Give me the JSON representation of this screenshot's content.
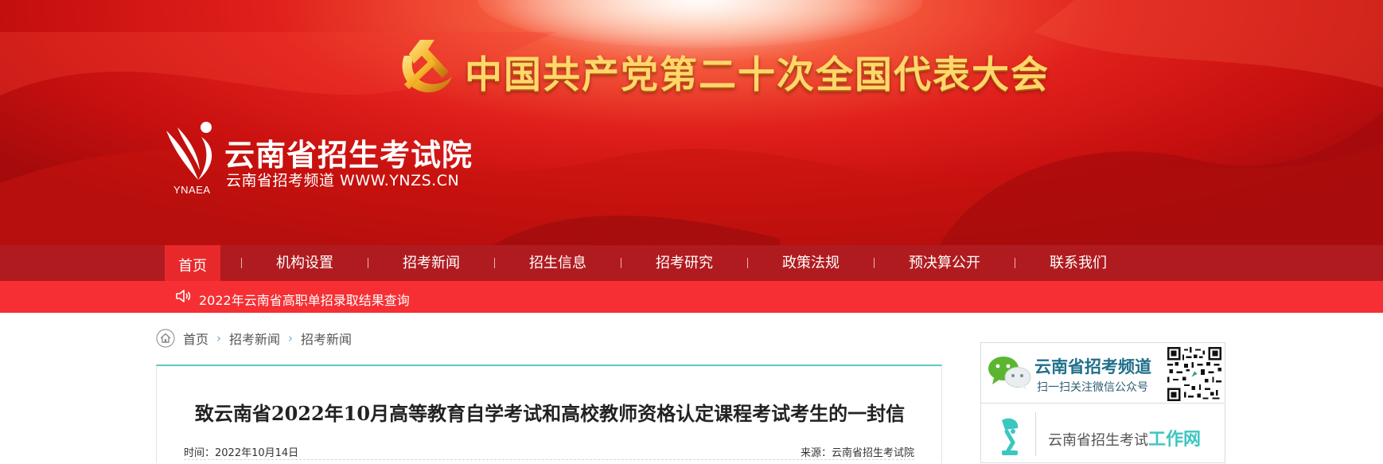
{
  "banner": {
    "congress_title": "中国共产党第二十次全国代表大会",
    "site_name": "云南省招生考试院",
    "site_subtitle": "云南省招考频道 WWW.YNZS.CN",
    "logo_abbr": "YNAEA"
  },
  "nav": {
    "items": [
      {
        "label": "首页"
      },
      {
        "label": "机构设置"
      },
      {
        "label": "招考新闻"
      },
      {
        "label": "招生信息"
      },
      {
        "label": "招考研究"
      },
      {
        "label": "政策法规"
      },
      {
        "label": "预决算公开"
      },
      {
        "label": "联系我们"
      }
    ],
    "active": "首页"
  },
  "ticker": {
    "text": "2022年云南省高职单招录取结果查询"
  },
  "breadcrumb": {
    "items": [
      "首页",
      "招考新闻",
      "招考新闻"
    ],
    "separator": "›"
  },
  "article": {
    "title": "致云南省2022年10月高等教育自学考试和高校教师资格认定课程考试考生的一封信",
    "time_label": "时间：2022年10月14日",
    "source_label": "来源：云南省招生考试院"
  },
  "sidebar": {
    "wechat_title": "云南省招考频道",
    "wechat_subtitle": "扫一扫关注微信公众号",
    "work_text": "云南省招生考试",
    "work_accent": "工作网"
  },
  "colors": {
    "nav_bg": "#b01b1f",
    "nav_active": "#e8292b",
    "ticker_bg": "#f52f33",
    "accent_teal": "#5ccbc2",
    "brand_blue": "#1f6f8b"
  }
}
